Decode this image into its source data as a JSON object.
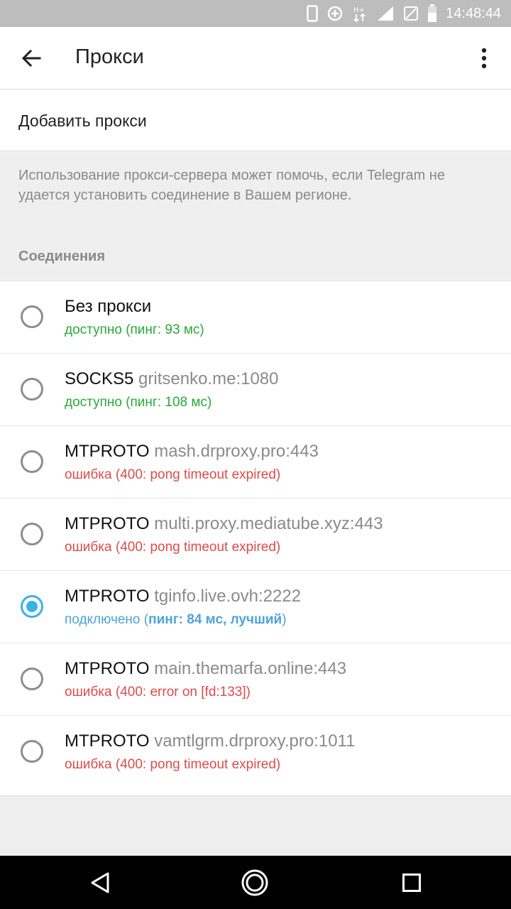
{
  "status_bar": {
    "time": "14:48:44",
    "icons": [
      "phone-icon",
      "data-saver-icon",
      "network-arrows-icon",
      "signal-icon",
      "sim-icon",
      "battery-icon"
    ]
  },
  "app_bar": {
    "title": "Прокси",
    "back_icon": "arrow-left-icon",
    "menu_icon": "more-vert-icon"
  },
  "add_proxy": {
    "label": "Добавить прокси"
  },
  "info_text": "Использование прокси-сервера может помочь, если Telegram не удается установить соединение в Вашем регионе.",
  "section_header": "Соединения",
  "proxies": [
    {
      "type": "Без прокси",
      "host": "",
      "status": "доступно (пинг: 93 мс)",
      "state": "ok",
      "selected": false
    },
    {
      "type": "SOCKS5",
      "host": "gritsenko.me:1080",
      "status": "доступно (пинг: 108 мс)",
      "state": "ok",
      "selected": false
    },
    {
      "type": "MTPROTO",
      "host": "mash.drproxy.pro:443",
      "status": "ошибка (400: pong timeout expired)",
      "state": "error",
      "selected": false
    },
    {
      "type": "MTPROTO",
      "host": "multi.proxy.mediatube.xyz:443",
      "status": "ошибка (400: pong timeout expired)",
      "state": "error",
      "selected": false
    },
    {
      "type": "MTPROTO",
      "host": "tginfo.live.ovh:2222",
      "status_prefix": "подключено (",
      "status_bold": "пинг: 84 мс, лучший",
      "status_suffix": ")",
      "state": "connected",
      "selected": true
    },
    {
      "type": "MTPROTO",
      "host": "main.themarfa.online:443",
      "status": "ошибка (400: error on [fd:133])",
      "state": "error",
      "selected": false
    },
    {
      "type": "MTPROTO",
      "host": "vamtlgrm.drproxy.pro:1011",
      "status": "ошибка (400: pong timeout expired)",
      "state": "error",
      "selected": false
    }
  ],
  "colors": {
    "accent": "#3bb0ea",
    "ok": "#2aa83a",
    "error": "#dd4b4b",
    "connected": "#4ea3d8"
  },
  "nav_bar": {
    "icons": [
      "back-triangle-icon",
      "home-circle-icon",
      "recents-square-icon"
    ]
  }
}
